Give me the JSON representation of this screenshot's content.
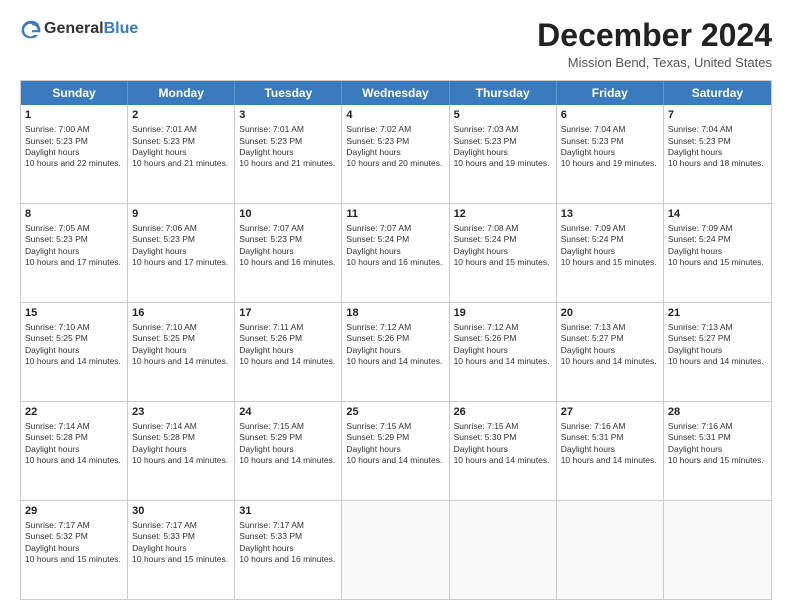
{
  "logo": {
    "general": "General",
    "blue": "Blue"
  },
  "header": {
    "month": "December 2024",
    "location": "Mission Bend, Texas, United States"
  },
  "weekdays": [
    "Sunday",
    "Monday",
    "Tuesday",
    "Wednesday",
    "Thursday",
    "Friday",
    "Saturday"
  ],
  "rows": [
    [
      {
        "day": "1",
        "sun": "7:00 AM",
        "set": "5:23 PM",
        "day_hours": "10 hours and 22 minutes."
      },
      {
        "day": "2",
        "sun": "7:01 AM",
        "set": "5:23 PM",
        "day_hours": "10 hours and 21 minutes."
      },
      {
        "day": "3",
        "sun": "7:01 AM",
        "set": "5:23 PM",
        "day_hours": "10 hours and 21 minutes."
      },
      {
        "day": "4",
        "sun": "7:02 AM",
        "set": "5:23 PM",
        "day_hours": "10 hours and 20 minutes."
      },
      {
        "day": "5",
        "sun": "7:03 AM",
        "set": "5:23 PM",
        "day_hours": "10 hours and 19 minutes."
      },
      {
        "day": "6",
        "sun": "7:04 AM",
        "set": "5:23 PM",
        "day_hours": "10 hours and 19 minutes."
      },
      {
        "day": "7",
        "sun": "7:04 AM",
        "set": "5:23 PM",
        "day_hours": "10 hours and 18 minutes."
      }
    ],
    [
      {
        "day": "8",
        "sun": "7:05 AM",
        "set": "5:23 PM",
        "day_hours": "10 hours and 17 minutes."
      },
      {
        "day": "9",
        "sun": "7:06 AM",
        "set": "5:23 PM",
        "day_hours": "10 hours and 17 minutes."
      },
      {
        "day": "10",
        "sun": "7:07 AM",
        "set": "5:23 PM",
        "day_hours": "10 hours and 16 minutes."
      },
      {
        "day": "11",
        "sun": "7:07 AM",
        "set": "5:24 PM",
        "day_hours": "10 hours and 16 minutes."
      },
      {
        "day": "12",
        "sun": "7:08 AM",
        "set": "5:24 PM",
        "day_hours": "10 hours and 15 minutes."
      },
      {
        "day": "13",
        "sun": "7:09 AM",
        "set": "5:24 PM",
        "day_hours": "10 hours and 15 minutes."
      },
      {
        "day": "14",
        "sun": "7:09 AM",
        "set": "5:24 PM",
        "day_hours": "10 hours and 15 minutes."
      }
    ],
    [
      {
        "day": "15",
        "sun": "7:10 AM",
        "set": "5:25 PM",
        "day_hours": "10 hours and 14 minutes."
      },
      {
        "day": "16",
        "sun": "7:10 AM",
        "set": "5:25 PM",
        "day_hours": "10 hours and 14 minutes."
      },
      {
        "day": "17",
        "sun": "7:11 AM",
        "set": "5:26 PM",
        "day_hours": "10 hours and 14 minutes."
      },
      {
        "day": "18",
        "sun": "7:12 AM",
        "set": "5:26 PM",
        "day_hours": "10 hours and 14 minutes."
      },
      {
        "day": "19",
        "sun": "7:12 AM",
        "set": "5:26 PM",
        "day_hours": "10 hours and 14 minutes."
      },
      {
        "day": "20",
        "sun": "7:13 AM",
        "set": "5:27 PM",
        "day_hours": "10 hours and 14 minutes."
      },
      {
        "day": "21",
        "sun": "7:13 AM",
        "set": "5:27 PM",
        "day_hours": "10 hours and 14 minutes."
      }
    ],
    [
      {
        "day": "22",
        "sun": "7:14 AM",
        "set": "5:28 PM",
        "day_hours": "10 hours and 14 minutes."
      },
      {
        "day": "23",
        "sun": "7:14 AM",
        "set": "5:28 PM",
        "day_hours": "10 hours and 14 minutes."
      },
      {
        "day": "24",
        "sun": "7:15 AM",
        "set": "5:29 PM",
        "day_hours": "10 hours and 14 minutes."
      },
      {
        "day": "25",
        "sun": "7:15 AM",
        "set": "5:29 PM",
        "day_hours": "10 hours and 14 minutes."
      },
      {
        "day": "26",
        "sun": "7:15 AM",
        "set": "5:30 PM",
        "day_hours": "10 hours and 14 minutes."
      },
      {
        "day": "27",
        "sun": "7:16 AM",
        "set": "5:31 PM",
        "day_hours": "10 hours and 14 minutes."
      },
      {
        "day": "28",
        "sun": "7:16 AM",
        "set": "5:31 PM",
        "day_hours": "10 hours and 15 minutes."
      }
    ],
    [
      {
        "day": "29",
        "sun": "7:17 AM",
        "set": "5:32 PM",
        "day_hours": "10 hours and 15 minutes."
      },
      {
        "day": "30",
        "sun": "7:17 AM",
        "set": "5:33 PM",
        "day_hours": "10 hours and 15 minutes."
      },
      {
        "day": "31",
        "sun": "7:17 AM",
        "set": "5:33 PM",
        "day_hours": "10 hours and 16 minutes."
      },
      null,
      null,
      null,
      null
    ]
  ]
}
